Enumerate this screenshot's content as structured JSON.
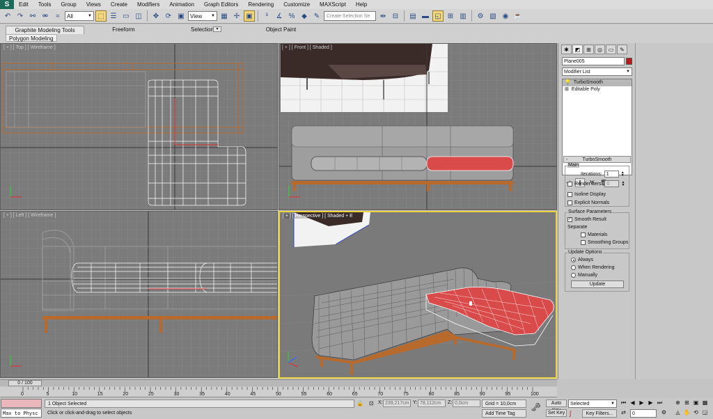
{
  "app": {
    "logo": "S"
  },
  "menu": [
    "Edit",
    "Tools",
    "Group",
    "Views",
    "Create",
    "Modifiers",
    "Animation",
    "Graph Editors",
    "Rendering",
    "Customize",
    "MAXScript",
    "Help"
  ],
  "toolbar": {
    "filter_value": "All",
    "ref_coord_value": "View",
    "named_selection_placeholder": "Create Selection Se"
  },
  "ribbon": {
    "tabs": [
      "Graphite Modeling Tools",
      "Freeform",
      "Selection",
      "Object Paint"
    ],
    "active_tab": "Graphite Modeling Tools",
    "sub_panel": "Polygon Modeling"
  },
  "viewports": {
    "top": {
      "label": "[ + ] [ Top ] [ Wireframe ]"
    },
    "front": {
      "label": "[ + ] [ Front ] [ Shaded ]"
    },
    "left": {
      "label": "[ + ] [ Left ] [ Wireframe ]"
    },
    "perspective": {
      "label": "[ + ] [ Perspective ] [ Shaded + E"
    }
  },
  "command_panel": {
    "object_name": "Plane005",
    "object_color": "#b51b1b",
    "modifier_list": "Modifier List",
    "stack": [
      {
        "label": "TurboSmooth",
        "selected": true
      },
      {
        "label": "Editable Poly",
        "selected": false
      }
    ],
    "turbosmooth": {
      "title": "TurboSmooth",
      "main_group": "Main",
      "iterations_label": "Iterations:",
      "iterations_value": "1",
      "render_iters_label": "Render Iters:",
      "render_iters_value": "0",
      "isoline_label": "Isoline Display",
      "explicit_normals_label": "Explicit Normals",
      "surface_group": "Surface Parameters",
      "smooth_result_label": "Smooth Result",
      "separate_label": "Separate",
      "materials_label": "Materials",
      "smoothing_groups_label": "Smoothing Groups",
      "update_group": "Update Options",
      "always_label": "Always",
      "when_rendering_label": "When Rendering",
      "manually_label": "Manually",
      "update_button": "Update"
    }
  },
  "timeline": {
    "slider_label": "0 / 100",
    "ticks": [
      "0",
      "5",
      "10",
      "15",
      "20",
      "25",
      "30",
      "35",
      "40",
      "45",
      "50",
      "55",
      "60",
      "65",
      "70",
      "75",
      "80",
      "85",
      "90",
      "95",
      "100"
    ]
  },
  "status": {
    "maxscript_text": "Max to Physc",
    "selection_info": "1 Object Selected",
    "prompt": "Click or click-and-drag to select objects",
    "x_label": "X:",
    "x_value": "239,217cm",
    "y_label": "Y:",
    "y_value": "78,112cm",
    "z_label": "Z:",
    "z_value": "0,0cm",
    "grid": "Grid = 10,0cm",
    "add_time_tag": "Add Time Tag",
    "auto_key": "Auto Key",
    "set_key": "Set Key",
    "selected_value": "Selected",
    "key_filters": "Key Filters...",
    "frame_value": "0"
  },
  "colors": {
    "active_viewport": "#e9d43e",
    "selection_red": "#d94a4a",
    "wood": "#b86a2c"
  }
}
